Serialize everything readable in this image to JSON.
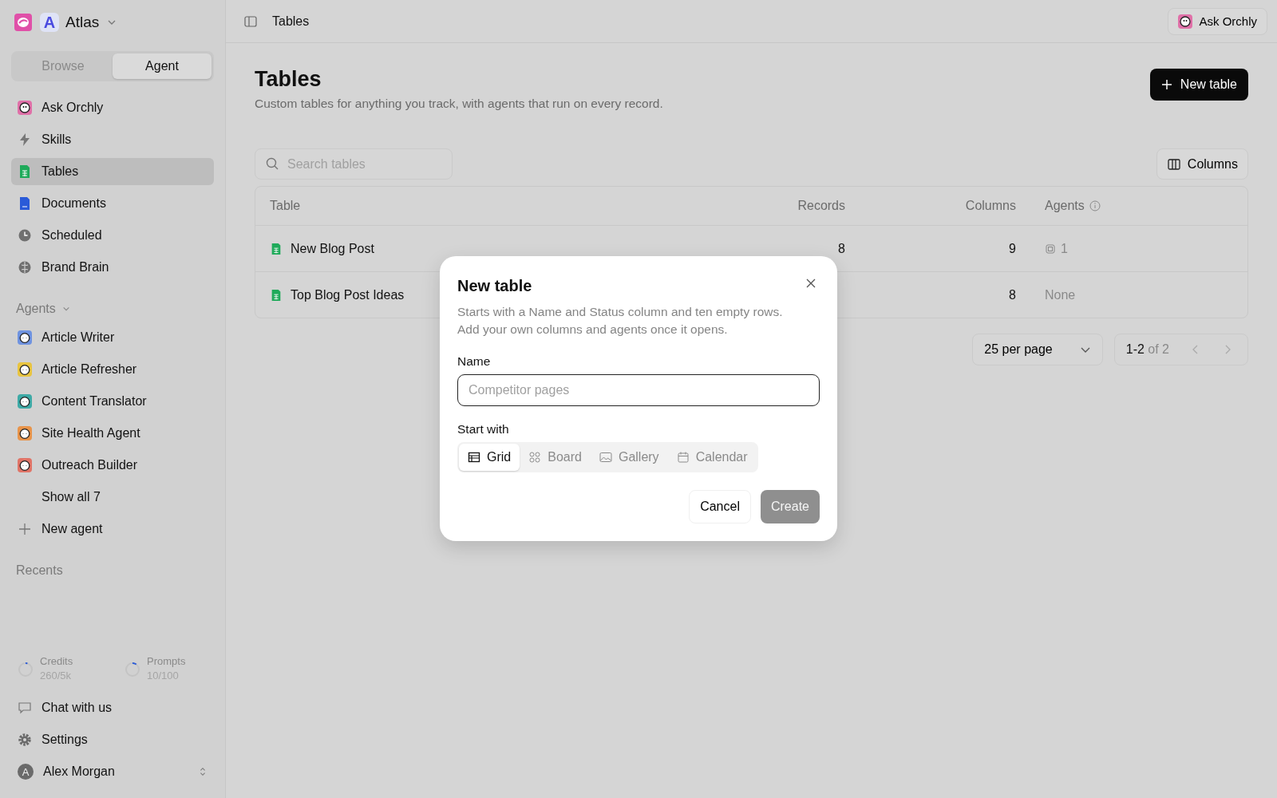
{
  "workspace": {
    "initial": "A",
    "name": "Atlas"
  },
  "mode_tabs": [
    {
      "label": "Browse",
      "selected": false
    },
    {
      "label": "Agent",
      "selected": true
    }
  ],
  "nav": [
    {
      "label": "Ask Orchly",
      "selected": false
    },
    {
      "label": "Skills",
      "selected": false
    },
    {
      "label": "Tables",
      "selected": true
    },
    {
      "label": "Documents",
      "selected": false
    },
    {
      "label": "Scheduled",
      "selected": false
    },
    {
      "label": "Brand Brain",
      "selected": false
    }
  ],
  "agents_section": {
    "title": "Agents",
    "items": [
      {
        "label": "Article Writer",
        "color": "#6f93e0"
      },
      {
        "label": "Article Refresher",
        "color": "#e8c440"
      },
      {
        "label": "Content Translator",
        "color": "#3eaaa6"
      },
      {
        "label": "Site Health Agent",
        "color": "#e8944a"
      },
      {
        "label": "Outreach Builder",
        "color": "#e07467"
      }
    ],
    "show_all": "Show all 7",
    "new_agent": "New agent"
  },
  "recents_title": "Recents",
  "usage": [
    {
      "label": "Credits",
      "value": "260/5k",
      "level": 0.05
    },
    {
      "label": "Prompts",
      "value": "10/100",
      "level": 0.1
    }
  ],
  "footer": {
    "chat": "Chat with us",
    "settings": "Settings",
    "user": {
      "initial": "A",
      "name": "Alex Morgan"
    }
  },
  "topbar": {
    "title": "Tables",
    "ask_button": "Ask Orchly"
  },
  "page": {
    "title": "Tables",
    "subtitle": "Custom tables for anything you track, with agents that run on every record.",
    "new_button": "New table",
    "search": {
      "placeholder": "Search tables"
    },
    "columns_button": "Columns"
  },
  "table": {
    "columns": [
      "Table",
      "Records",
      "Columns",
      "Agents"
    ],
    "rows": [
      {
        "name": "New Blog Post",
        "records": "8",
        "columns": "9",
        "agents": "1"
      },
      {
        "name": "Top Blog Post Ideas",
        "columns": "8",
        "agents": "None"
      }
    ]
  },
  "pagination": {
    "per_page": "25 per page",
    "range": "1-2",
    "of": "of 2"
  },
  "modal": {
    "title": "New table",
    "description": "Starts with a Name and Status column and ten empty rows. Add your own columns and agents once it opens.",
    "name_label": "Name",
    "name_placeholder": "Competitor pages",
    "start_label": "Start with",
    "options": [
      {
        "label": "Grid",
        "selected": true
      },
      {
        "label": "Board",
        "selected": false
      },
      {
        "label": "Gallery",
        "selected": false
      },
      {
        "label": "Calendar",
        "selected": false
      }
    ],
    "cancel": "Cancel",
    "create": "Create"
  }
}
